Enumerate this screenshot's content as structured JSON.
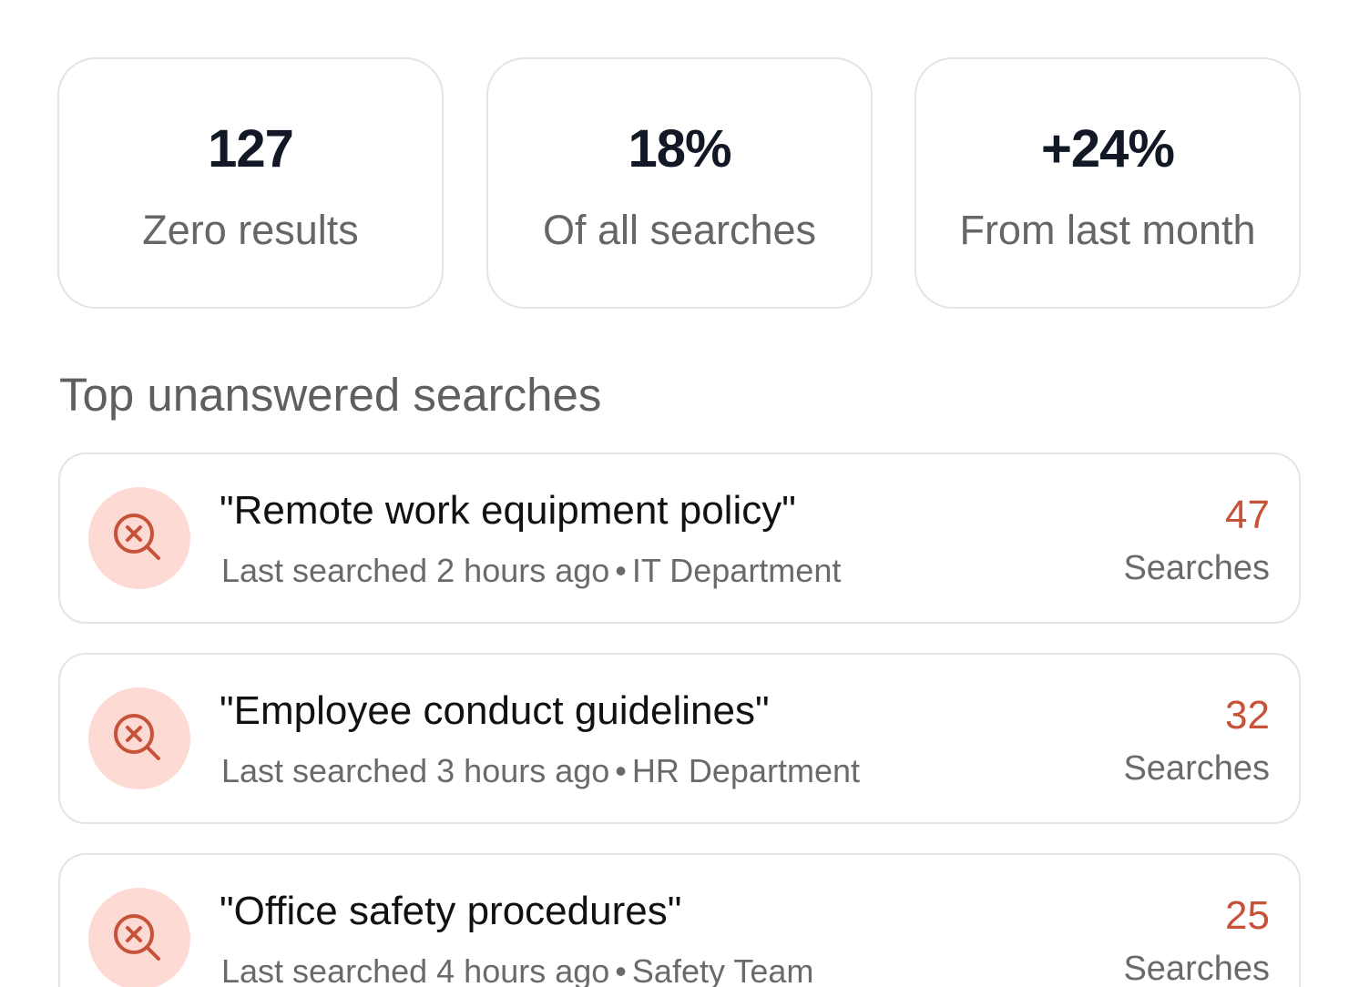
{
  "stats": [
    {
      "value": "127",
      "label": "Zero results"
    },
    {
      "value": "18%",
      "label": "Of all searches"
    },
    {
      "value": "+24%",
      "label": "From last month"
    }
  ],
  "section_title": "Top unanswered searches",
  "searches": [
    {
      "query": "\"Remote work equipment policy\"",
      "time": "Last searched 2 hours ago",
      "source": "IT Department",
      "count": "47",
      "count_label": "Searches",
      "icon": "search-x-icon"
    },
    {
      "query": "\"Employee conduct guidelines\"",
      "time": "Last searched 3 hours ago",
      "source": "HR Department",
      "count": "32",
      "count_label": "Searches",
      "icon": "search-x-icon"
    },
    {
      "query": "\"Office safety procedures\"",
      "time": "Last searched 4 hours ago",
      "source": "Safety Team",
      "count": "25",
      "count_label": "Searches",
      "icon": "search-x-icon"
    }
  ],
  "colors": {
    "accent": "#c65339",
    "icon_bg": "#fddad3",
    "border": "#e4e4e4"
  }
}
